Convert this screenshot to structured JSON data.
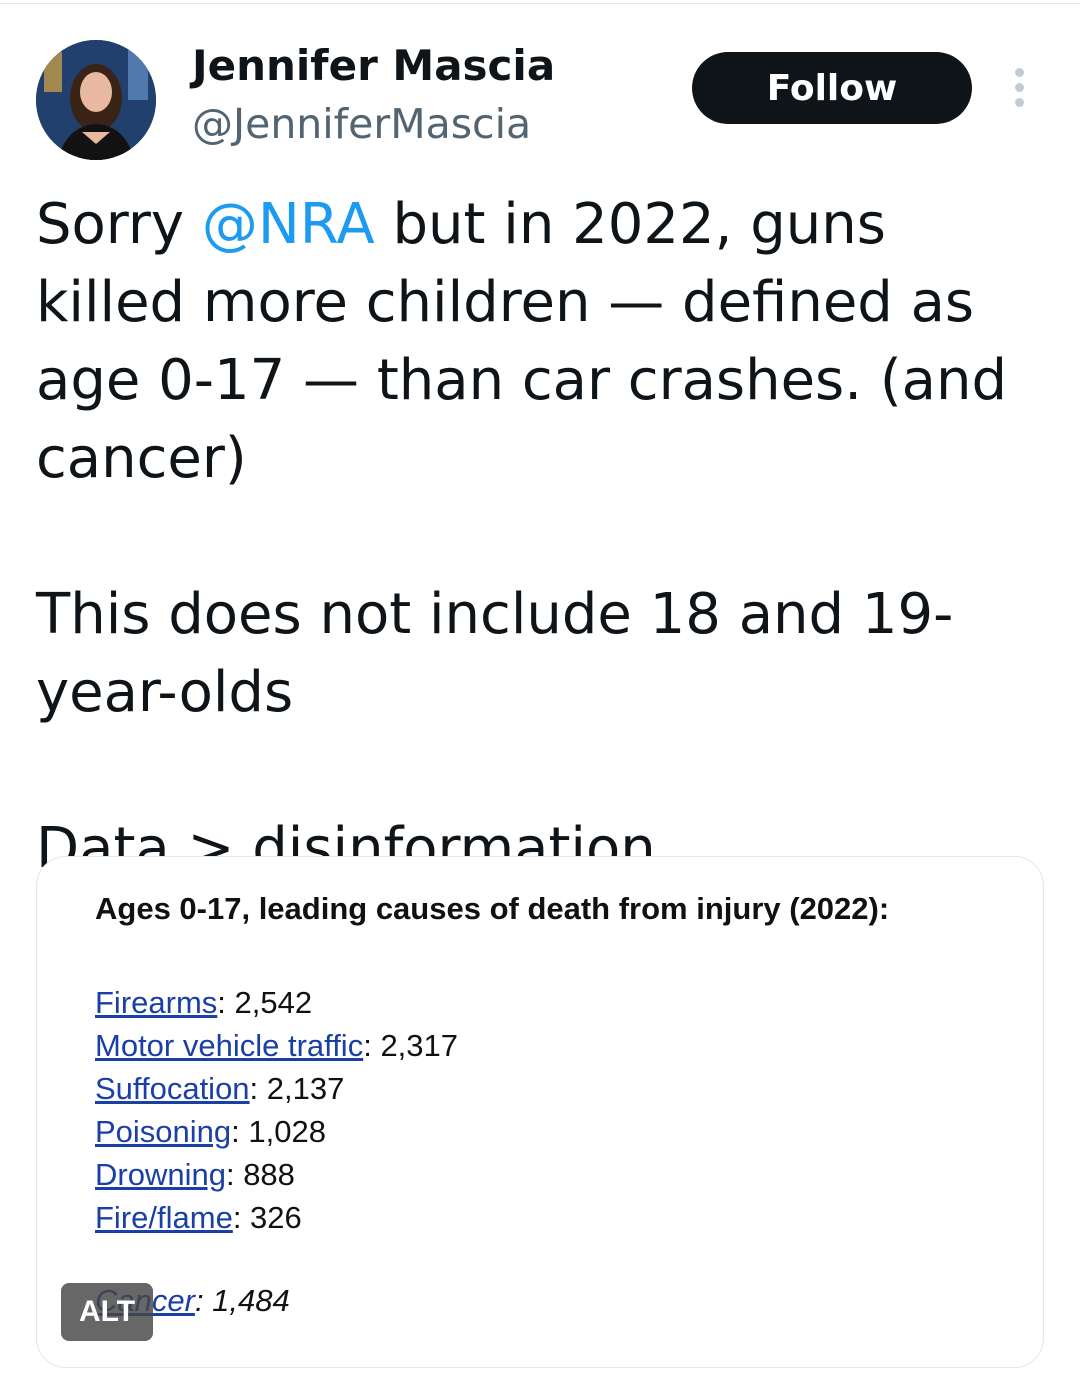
{
  "author": {
    "name": "Jennifer Mascia",
    "handle": "@JenniferMascia",
    "follow_label": "Follow"
  },
  "tweet": {
    "line1_before": "Sorry ",
    "mention": "@NRA",
    "line1_after": " but in 2022, guns killed more children — defined as age 0-17 — than car crashes. (and cancer)",
    "paragraph2": "This does not include 18 and 19-year-olds",
    "paragraph3": "Data > disinformation"
  },
  "media": {
    "title": "Ages 0-17, leading causes of death from injury (2022):",
    "causes": [
      {
        "label": "Firearms",
        "value": "2,542"
      },
      {
        "label": "Motor vehicle traffic",
        "value": "2,317"
      },
      {
        "label": "Suffocation",
        "value": "2,137"
      },
      {
        "label": "Poisoning",
        "value": "1,028"
      },
      {
        "label": "Drowning",
        "value": "888"
      },
      {
        "label": "Fire/flame",
        "value": "326"
      }
    ],
    "cancer": {
      "label": "Cancer",
      "value": "1,484"
    },
    "alt_badge": "ALT"
  },
  "icons": {
    "more": "more-vertical-icon"
  },
  "colors": {
    "mention": "#1d9bf0",
    "follow_bg": "#0f1419",
    "link": "#1a3fa6"
  }
}
